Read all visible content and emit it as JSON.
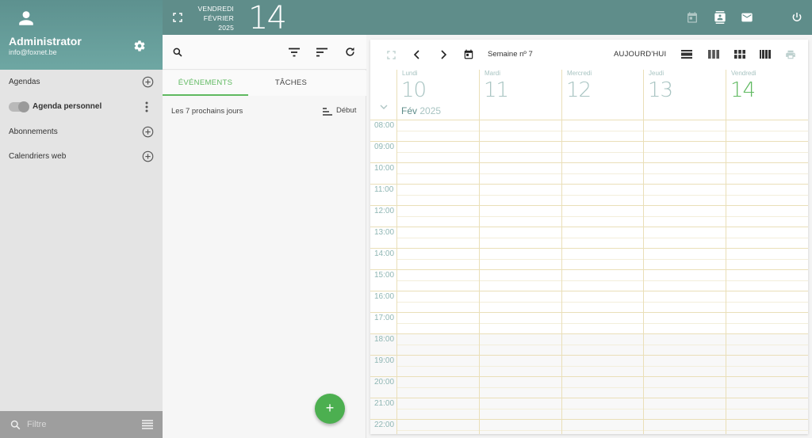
{
  "user": {
    "name": "Administrator",
    "email": "info@foxnet.be"
  },
  "sidebar": {
    "agendas_label": "Agendas",
    "personal_agenda_label": "Agenda personnel",
    "personal_agenda_enabled": false,
    "subscriptions_label": "Abonnements",
    "web_calendars_label": "Calendriers web",
    "filter_placeholder": "Filtre"
  },
  "topbar": {
    "weekday": "VENDREDI",
    "month": "FÉVRIER",
    "year": "2025",
    "day": "14"
  },
  "events_panel": {
    "tabs": [
      "ÉVÉNEMENTS",
      "TÂCHES"
    ],
    "active_tab": "ÉVÉNEMENTS",
    "upcoming_label": "Les 7 prochains jours",
    "sort_label": "Début",
    "add_button": "+"
  },
  "calendar": {
    "week_label": "Semaine nº 7",
    "today_label": "AUJOURD'HUI",
    "days": [
      {
        "name": "Lundi",
        "num": "10"
      },
      {
        "name": "Mardi",
        "num": "11"
      },
      {
        "name": "Mercredi",
        "num": "12"
      },
      {
        "name": "Jeudi",
        "num": "13"
      },
      {
        "name": "Vendredi",
        "num": "14"
      }
    ],
    "today_index": 4,
    "month_short": "Fév",
    "year": "2025",
    "hours": [
      "08:00",
      "09:00",
      "10:00",
      "11:00",
      "12:00",
      "13:00",
      "14:00",
      "15:00",
      "16:00",
      "17:00",
      "18:00",
      "19:00",
      "20:00",
      "21:00",
      "22:00"
    ]
  },
  "colors": {
    "header_teal": "#5f8d8a",
    "accent_green": "#5fb960",
    "fab_green": "#4caf50",
    "grid_line": "#eadfb8"
  }
}
